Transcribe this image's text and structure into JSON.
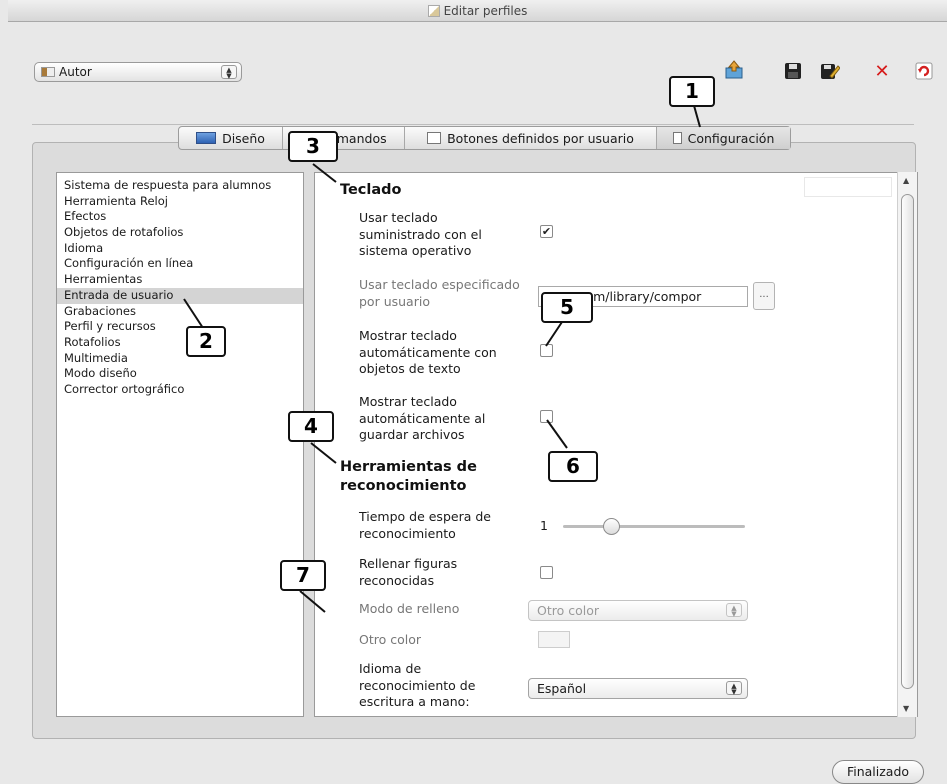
{
  "window": {
    "title": "Editar perfiles"
  },
  "profile_select": {
    "value": "Autor",
    "icon": "user-profile-icon"
  },
  "toolbar": {
    "icons": [
      "export-profile-icon",
      "save-icon",
      "rename-icon",
      "delete-icon",
      "reset-icon"
    ]
  },
  "tabs": [
    {
      "label": "Diseño",
      "icon": "design-tab-icon"
    },
    {
      "label": "Comandos",
      "icon": "commands-tab-icon"
    },
    {
      "label": "Botones definidos por usuario",
      "icon": "user-buttons-tab-icon"
    },
    {
      "label": "Configuración",
      "icon": "settings-tab-icon"
    }
  ],
  "categories": [
    "Sistema de respuesta para alumnos",
    "Herramienta Reloj",
    "Efectos",
    "Objetos de rotafolios",
    "Idioma",
    "Configuración en línea",
    "Herramientas",
    "Entrada de usuario",
    "Grabaciones",
    "Perfil y recursos",
    "Rotafolios",
    "Multimedia",
    "Modo diseño",
    "Corrector ortográfico"
  ],
  "selected_category": "Entrada de usuario",
  "keyboard": {
    "heading": "Teclado",
    "use_os_keyboard_label": "Usar teclado suministrado con el sistema operativo",
    "use_os_keyboard_checked": true,
    "user_keyboard_label": "Usar teclado especificado por usuario",
    "user_keyboard_path": "o:/system/library/compor",
    "browse_label": "...",
    "show_with_text_label": "Mostrar teclado automáticamente con objetos de texto",
    "show_with_text_checked": false,
    "show_on_save_label": "Mostrar teclado automáticamente al guardar archivos",
    "show_on_save_checked": false
  },
  "recognition": {
    "heading": "Herramientas de reconocimiento",
    "timeout_label": "Tiempo de espera de reconocimiento",
    "timeout_value": "1",
    "timeout_slider_fraction": 0.24,
    "fill_shapes_label": "Rellenar figuras reconocidas",
    "fill_shapes_checked": false,
    "fill_mode_label": "Modo de relleno",
    "fill_mode_value": "Otro color",
    "other_color_label": "Otro color",
    "handwriting_lang_label": "Idioma de reconocimiento de escritura a mano:",
    "handwriting_lang_value": "Español"
  },
  "callouts": [
    "1",
    "2",
    "3",
    "4",
    "5",
    "6",
    "7"
  ],
  "footer": {
    "done_label": "Finalizado"
  }
}
